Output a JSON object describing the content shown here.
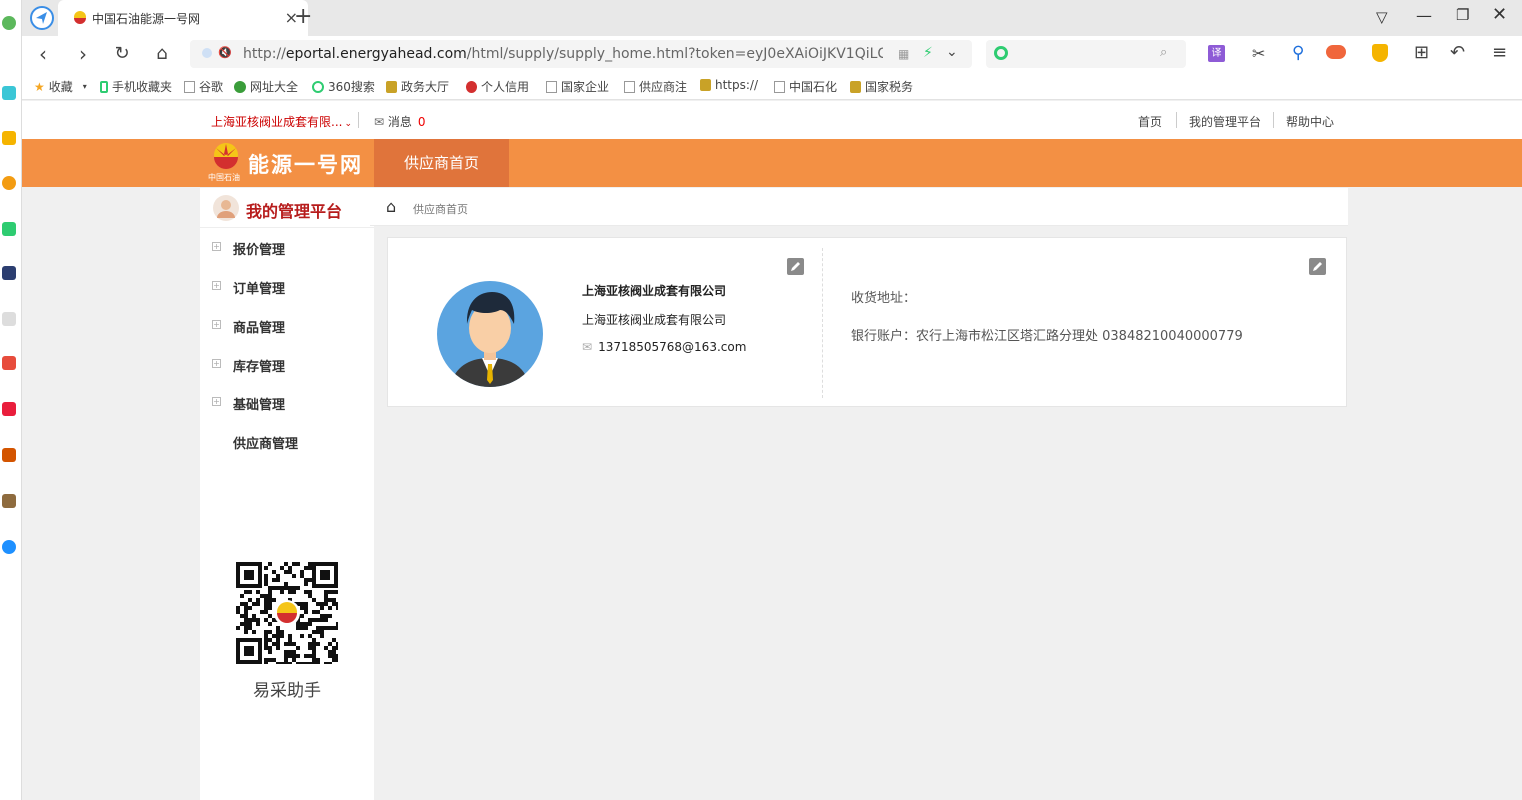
{
  "browser": {
    "tab_title": "中国石油能源一号网",
    "url_prefix": "http://",
    "url_domain": "eportal.energyahead.com",
    "url_path": "/html/supply/supply_home.html?token=eyJ0eXAiOiJKV1QiLCJhbGc",
    "bookmarks": [
      "收藏",
      "手机收藏夹",
      "谷歌",
      "网址大全",
      "360搜索",
      "政务大厅",
      "个人信用",
      "国家企业",
      "供应商注",
      "https://",
      "中国石化",
      "国家税务"
    ],
    "translate_label": "译"
  },
  "site": {
    "company_selector": "上海亚核阀业成套有限...",
    "messages_label": "消息",
    "messages_count": "0",
    "top_links": [
      "首页",
      "我的管理平台",
      "帮助中心"
    ],
    "brand_name": "能源一号网",
    "brand_sub": "中国石油",
    "header_tab": "供应商首页",
    "colors": {
      "accent": "#f39044",
      "accent_dark": "#e0743b",
      "title_red": "#b71c1c"
    }
  },
  "menu": {
    "title": "我的管理平台",
    "items": [
      "报价管理",
      "订单管理",
      "商品管理",
      "库存管理",
      "基础管理",
      "供应商管理"
    ],
    "qr_label": "易采助手"
  },
  "breadcrumb": "供应商首页",
  "profile": {
    "company_name": "上海亚核阀业成套有限公司",
    "company_name2": "上海亚核阀业成套有限公司",
    "email": "13718505768@163.com",
    "address_label": "收货地址：",
    "bank_label": "银行账户：农行上海市松江区塔汇路分理处 03848210040000779"
  }
}
